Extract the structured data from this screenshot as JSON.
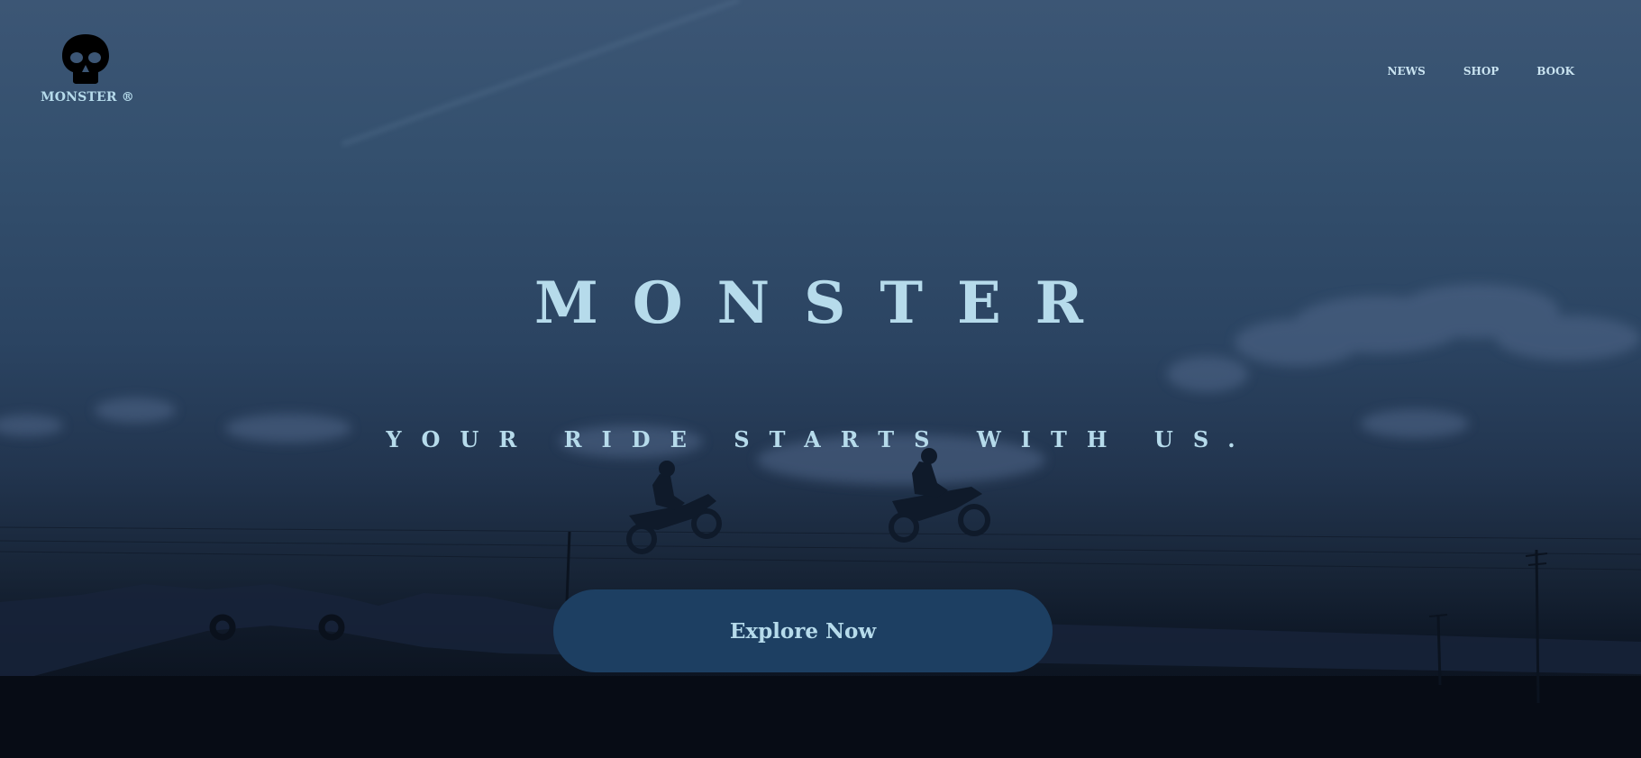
{
  "brand": {
    "name": "MONSTER ®",
    "logo_icon": "skull-icon"
  },
  "nav": {
    "items": [
      {
        "label": "NEWS"
      },
      {
        "label": "SHOP"
      },
      {
        "label": "BOOK"
      }
    ]
  },
  "hero": {
    "title": "MONSTER",
    "subtitle": "YOUR RIDE STARTS WITH US.",
    "cta_label": "Explore Now",
    "background_image": "dusk-sky-motocross-silhouette"
  },
  "colors": {
    "text": "#b6dbeb",
    "button": "#1d3f62",
    "sky_top": "#3c5675",
    "ground": "#080e18"
  }
}
